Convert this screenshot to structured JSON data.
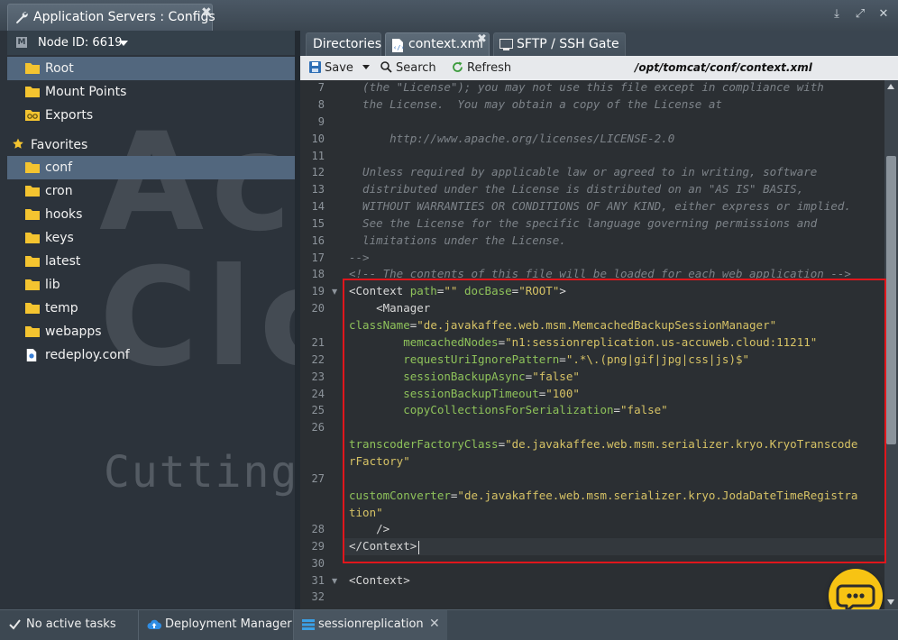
{
  "window": {
    "title": "Application Servers : Configs",
    "icon": "wrench-icon"
  },
  "left_panel": {
    "node_label": "Node ID: 6619",
    "tree": [
      {
        "label": "Root",
        "icon": "folder-icon",
        "selected": true
      },
      {
        "label": "Mount Points",
        "icon": "folder-icon"
      },
      {
        "label": "Exports",
        "icon": "exports-icon"
      }
    ],
    "favorites_label": "Favorites",
    "favorites": [
      {
        "label": "conf",
        "icon": "folder-icon",
        "selected": true
      },
      {
        "label": "cron",
        "icon": "folder-icon"
      },
      {
        "label": "hooks",
        "icon": "folder-icon"
      },
      {
        "label": "keys",
        "icon": "folder-icon"
      },
      {
        "label": "latest",
        "icon": "folder-icon"
      },
      {
        "label": "lib",
        "icon": "folder-icon"
      },
      {
        "label": "temp",
        "icon": "folder-icon"
      },
      {
        "label": "webapps",
        "icon": "folder-icon"
      },
      {
        "label": "redeploy.conf",
        "icon": "config-file-icon"
      }
    ]
  },
  "tabs": [
    {
      "label": "Directories"
    },
    {
      "label": "context.xml",
      "active": true
    },
    {
      "label": "SFTP / SSH Gate"
    }
  ],
  "toolbar": {
    "save": "Save",
    "search": "Search",
    "refresh": "Refresh",
    "path": "/opt/tomcat/conf/context.xml"
  },
  "editor": {
    "line_numbers": [
      "7",
      "8",
      "9",
      "10",
      "11",
      "12",
      "13",
      "14",
      "15",
      "16",
      "17",
      "18",
      "19",
      "20",
      "21",
      "22",
      "23",
      "24",
      "25",
      "26",
      "27",
      "28",
      "29",
      "30",
      "31",
      "32"
    ],
    "lines": {
      "l7": "  (the \"License\"); you may not use this file except in compliance with",
      "l8": "  the License.  You may obtain a copy of the License at",
      "l10": "      http://www.apache.org/licenses/LICENSE-2.0",
      "l12": "  Unless required by applicable law or agreed to in writing, software",
      "l13": "  distributed under the License is distributed on an \"AS IS\" BASIS,",
      "l14": "  WITHOUT WARRANTIES OR CONDITIONS OF ANY KIND, either express or implied.",
      "l15": "  See the License for the specific language governing permissions and",
      "l16": "  limitations under the License.",
      "l17": "-->",
      "l18": "<!-- The contents of this file will be loaded for each web application -->",
      "l19_tag": "<Context ",
      "l19_a1": "path",
      "l19_v1": "\"\"",
      "l19_a2": " docBase",
      "l19_v2": "\"ROOT\"",
      "l19_end": ">",
      "l20": "    <Manager",
      "l20b_a": "className",
      "l20b_v": "\"de.javakaffee.web.msm.MemcachedBackupSessionManager\"",
      "l21_a": "        memcachedNodes",
      "l21_v": "\"n1:sessionreplication.us-accuweb.cloud:11211\"",
      "l22_a": "        requestUriIgnorePattern",
      "l22_v": "\".*\\.(png|gif|jpg|css|js)$\"",
      "l23_a": "        sessionBackupAsync",
      "l23_v": "\"false\"",
      "l24_a": "        sessionBackupTimeout",
      "l24_v": "\"100\"",
      "l25_a": "        copyCollectionsForSerialization",
      "l25_v": "\"false\"",
      "l26_a": "transcoderFactoryClass",
      "l26_v": "\"de.javakaffee.web.msm.serializer.kryo.KryoTranscode",
      "l26_v2": "rFactory\"",
      "l27_a": "customConverter",
      "l27_v": "\"de.javakaffee.web.msm.serializer.kryo.JodaDateTimeRegistra",
      "l27_v2": "tion\"",
      "l28": "    />",
      "l29": "</Context>",
      "l31": "<Context>"
    }
  },
  "watermark": {
    "brand_line1": "Accuweb",
    "brand_line2": "Cloud",
    "tagline": "Cutting Edge Cloud Hosting"
  },
  "bottom_bar": [
    {
      "label": "No active tasks",
      "icon": "check-icon"
    },
    {
      "label": "Deployment Manager",
      "icon": "cloud-upload-icon"
    },
    {
      "label": "sessionreplication",
      "icon": "environment-icon",
      "active": true
    }
  ],
  "colors": {
    "highlight": "#e0161c",
    "chat_button": "#f7c313",
    "selection": "#52677e"
  }
}
